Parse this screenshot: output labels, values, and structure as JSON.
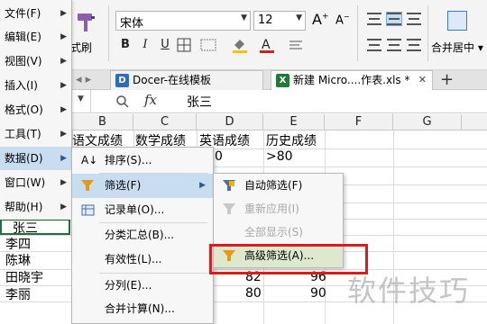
{
  "ribbon": {
    "paint_label": "式刷",
    "font_name": "宋体",
    "font_size": "12",
    "bold": "B",
    "italic": "I",
    "underline": "U",
    "grow_font": "A⁺",
    "shrink_font": "A⁻",
    "merge_label": "合并居中",
    "accent_color": "#3c78c3"
  },
  "tabs": [
    {
      "label": "Docer-在线模板",
      "icon": "docer-icon"
    },
    {
      "label": "新建 Micro....作表.xls *",
      "icon": "excel-icon"
    }
  ],
  "formula_bar": {
    "fx": "fx",
    "value": "张三"
  },
  "columns": [
    "B",
    "C",
    "D",
    "E",
    "F",
    "G"
  ],
  "header_row": [
    "语文成绩",
    "数学成绩",
    "英语成绩",
    "历史成绩"
  ],
  "filter_row": {
    "d": "0",
    "e": ">80"
  },
  "names": [
    "张三",
    "李四",
    "陈琳",
    "田晓宇",
    "李丽"
  ],
  "data_cells": [
    {
      "d": "82",
      "e": "96"
    },
    {
      "d": "80",
      "e": "90"
    }
  ],
  "main_menu": [
    "文件(F)",
    "编辑(E)",
    "视图(V)",
    "插入(I)",
    "格式(O)",
    "工具(T)",
    "数据(D)",
    "窗口(W)",
    "帮助(H)"
  ],
  "data_menu": [
    "排序(S)...",
    "筛选(F)",
    "记录单(O)...",
    "分类汇总(B)...",
    "有效性(L)...",
    "分列(E)...",
    "合并计算(N)..."
  ],
  "filter_submenu": [
    "自动筛选(F)",
    "重新应用(I)",
    "全部显示(S)",
    "高级筛选(A)..."
  ],
  "watermark": "软件技巧"
}
